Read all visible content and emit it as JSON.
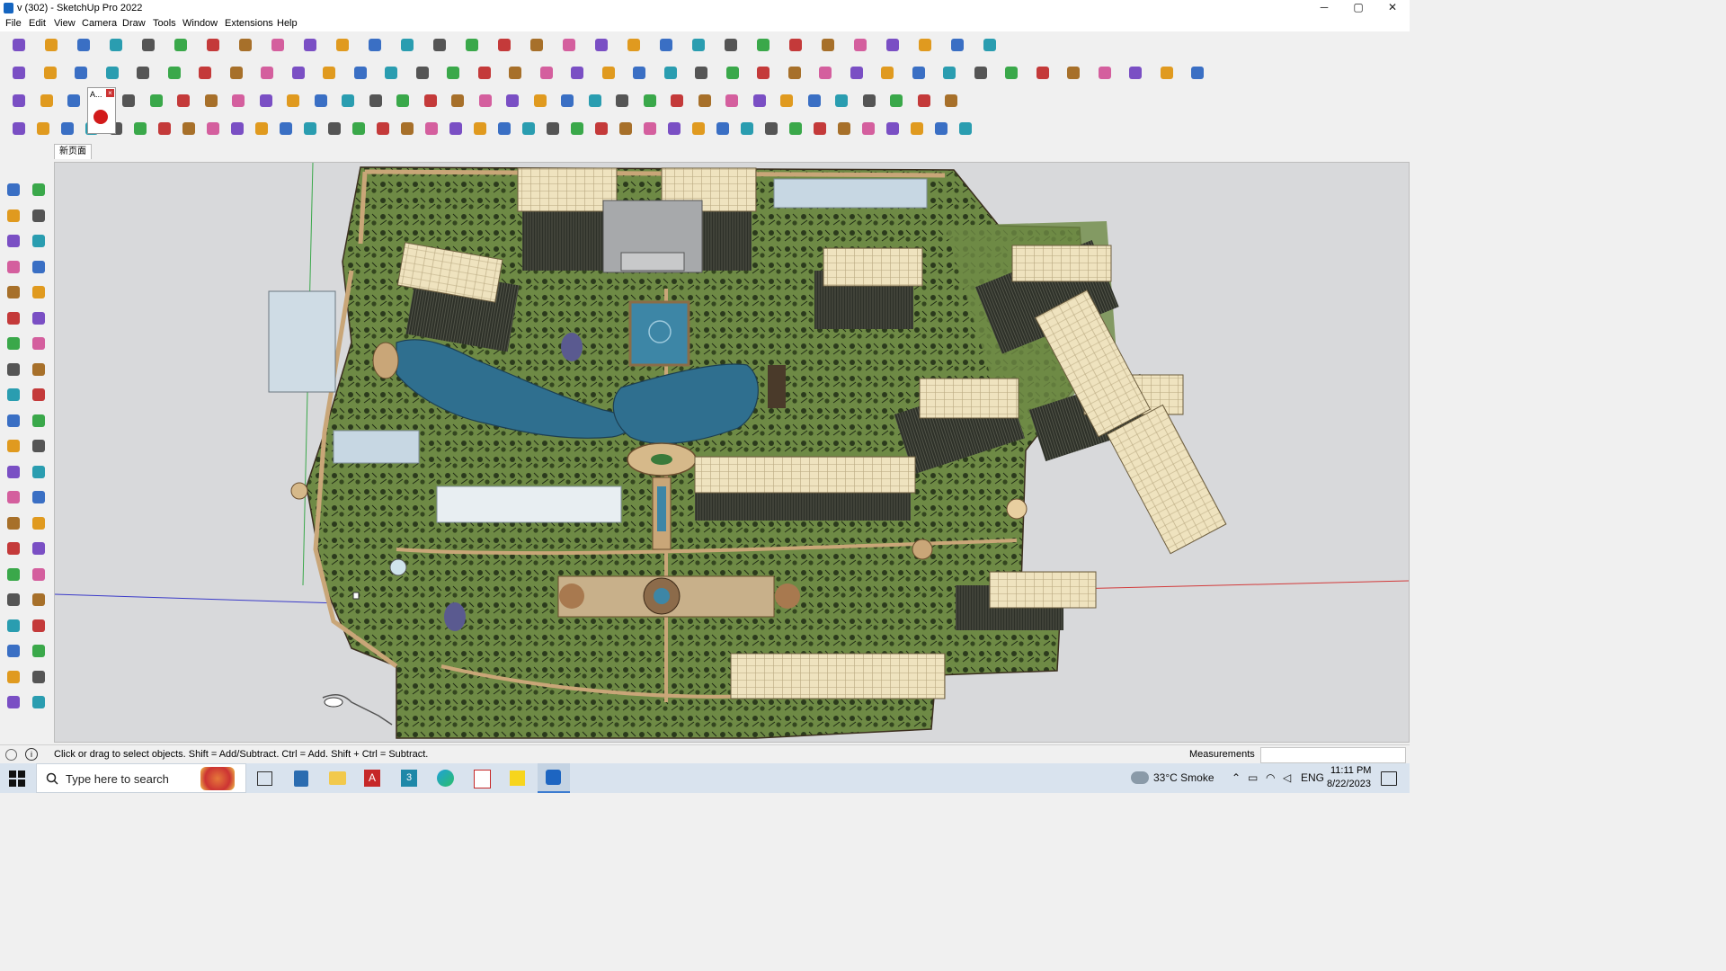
{
  "window": {
    "title": "v (302) - SketchUp Pro 2022",
    "minimize": "─",
    "maximize": "▢",
    "close": "✕"
  },
  "menu": [
    "File",
    "Edit",
    "View",
    "Camera",
    "Draw",
    "Tools",
    "Window",
    "Extensions",
    "Help"
  ],
  "toolbar_row1_icons": [
    "search-icon",
    "select-icon",
    "eraser-icon",
    "pencil-icon",
    "lasso-icon",
    "paint-icon",
    "push-pull-icon",
    "follow-me-icon",
    "move-icon",
    "rotate-icon",
    "scale-icon",
    "tape-icon",
    "text-icon",
    "paint-bucket-icon",
    "orbit-icon",
    "pan-icon",
    "zoom-icon",
    "zoom-extents-icon",
    "section-icon",
    "layers-icon",
    "styles-icon",
    "shadow-icon",
    "camera-icon",
    "component-icon",
    "group-icon",
    "flip-icon",
    "align-icon",
    "axis-icon",
    "undo-icon",
    "redo-icon",
    "settings-icon"
  ],
  "toolbar_row2_icons": [
    "box-icon",
    "sphere-icon",
    "cone-icon",
    "stair-icon",
    "arrow-up-icon",
    "arrow-down-icon",
    "arrow-r-icon",
    "arrow-v-icon",
    "arrow-n-icon",
    "arrow-f-icon",
    "curve-icon",
    "panel-icon",
    "panel-icon",
    "panel-icon",
    "cube-green-icon",
    "cube-green-icon",
    "house-icon",
    "house-icon",
    "house-icon",
    "house-icon",
    "house-icon",
    "text-tool-icon",
    "leaf-icon",
    "ruler-icon",
    "rect-icon",
    "circle-icon",
    "ellipse-icon",
    "polygon-icon",
    "arc-icon",
    "spline-icon",
    "magic-icon",
    "scissors-icon",
    "eraser-pink-icon",
    "brick-icon",
    "grid-icon",
    "lattice-icon",
    "hand-icon",
    "wall-icon",
    "roof-icon"
  ],
  "toolbar_row3_icons": [
    "plane-icon",
    "plane-icon",
    "plane-icon",
    "tag-icon",
    "arc-tool-icon",
    "fill-icon",
    "stack-icon",
    "frame-icon",
    "bridge-icon",
    "chain-icon",
    "curve-icon",
    "join-icon",
    "cross-icon",
    "cross-icon",
    "x-icon",
    "cone-icon",
    "tree-icon",
    "warn-icon",
    "bend-icon",
    "bend-icon",
    "spiral-icon",
    "snap-icon",
    "cup-icon",
    "hook-icon",
    "box-icon",
    "box-icon",
    "box-icon",
    "box-icon",
    "box-icon",
    "grid-icon",
    "grid-icon",
    "grid-icon",
    "x-icon",
    "points-icon",
    "qr-icon"
  ],
  "toolbar_row4_icons": [
    "shape-icon",
    "shape-icon",
    "shape-icon",
    "shape-icon",
    "shape-icon",
    "shape-icon",
    "shape-icon",
    "shape-icon",
    "shape-icon",
    "shape-icon",
    "shape-icon",
    "shape-icon",
    "shape-icon",
    "shape-icon",
    "shape-icon",
    "shape-icon",
    "shape-icon",
    "shape-icon",
    "shape-icon",
    "shape-icon",
    "shape-icon",
    "shape-icon",
    "shape-icon",
    "shape-icon",
    "shape-icon",
    "shape-icon",
    "shape-icon",
    "shape-icon",
    "shape-icon",
    "shape-icon",
    "shape-icon",
    "shape-icon",
    "shape-icon",
    "shape-icon",
    "shape-icon",
    "shape-icon",
    "shape-icon",
    "shape-icon",
    "shape-icon",
    "shape-icon"
  ],
  "popup_label": "A...",
  "scene_tab": "新页面",
  "status": {
    "hint": "Click or drag to select objects. Shift = Add/Subtract. Ctrl = Add. Shift + Ctrl = Subtract.",
    "measurements_label": "Measurements",
    "measurements_value": ""
  },
  "taskbar": {
    "search_placeholder": "Type here to search",
    "weather": "33°C  Smoke",
    "language": "ENG",
    "time": "11:11 PM",
    "date": "8/22/2023"
  },
  "colors": {
    "lawn": "#6e8a45",
    "water": "#2f6f8f",
    "building": "#efe3bf",
    "path": "#c9a678",
    "viewport_bg": "#d8d9db"
  }
}
